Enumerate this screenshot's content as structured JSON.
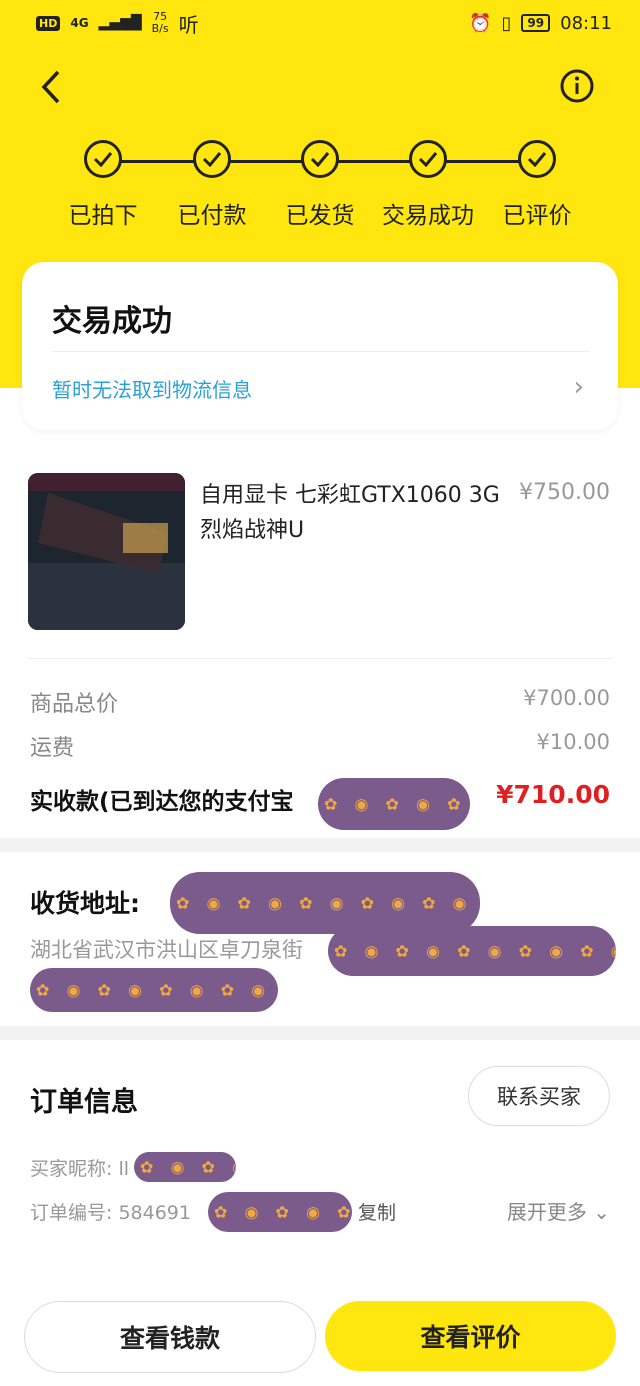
{
  "status_bar": {
    "hd": "HD",
    "signal": "4G",
    "speed_top": "75",
    "speed_bottom": "B/s",
    "listen": "听",
    "battery": "99",
    "time": "08:11"
  },
  "steps": [
    "已拍下",
    "已付款",
    "已发货",
    "交易成功",
    "已评价"
  ],
  "status_card": {
    "title": "交易成功",
    "logistics": "暂时无法取到物流信息"
  },
  "product": {
    "title": "自用显卡 七彩虹GTX1060 3G烈焰战神U",
    "price": "¥750.00"
  },
  "summary": {
    "total_label": "商品总价",
    "total_value": "¥700.00",
    "shipping_label": "运费",
    "shipping_value": "¥10.00",
    "received_label": "实收款(已到达您的支付宝",
    "received_value": "¥710.00"
  },
  "address": {
    "label": "收货地址:",
    "line1": "湖北省武汉市洪山区卓刀泉街"
  },
  "order": {
    "title": "订单信息",
    "contact_button": "联系买家",
    "buyer_label": "买家昵称: ll",
    "order_no_label": "订单编号: 584691",
    "copy": "复制",
    "more": "展开更多"
  },
  "actions": {
    "view_money": "查看钱款",
    "view_review": "查看评价"
  },
  "colors": {
    "accent": "#ffe60f",
    "price_red": "#e02020",
    "link_blue": "#2ba1d8"
  }
}
